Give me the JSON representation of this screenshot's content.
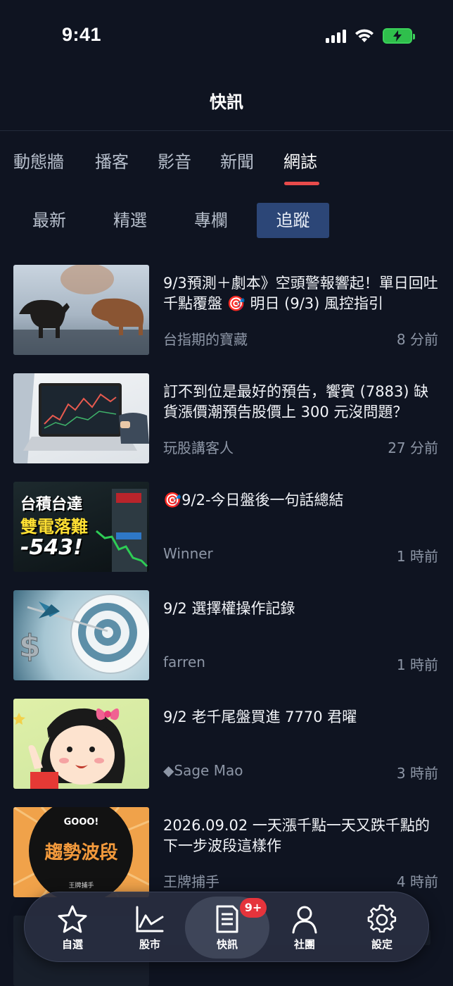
{
  "status": {
    "time": "9:41"
  },
  "header": {
    "title": "快訊"
  },
  "main_tabs": [
    "動態牆",
    "播客",
    "影音",
    "新聞",
    "網誌"
  ],
  "main_tab_active": "網誌",
  "sub_tabs": [
    "最新",
    "精選",
    "專欄",
    "追蹤"
  ],
  "sub_tab_active": "追蹤",
  "feed": [
    {
      "title": "9/3預測＋劇本》空頭警報響起！單日回吐千點覆盤 🎯 明日 (9/3) 風控指引",
      "author": "台指期的寶藏",
      "time": "8 分前"
    },
    {
      "title": "訂不到位是最好的預告，饗賓 (7883) 缺貨漲價潮預告股價上 300 元沒問題？",
      "author": "玩股講客人",
      "time": "27 分前"
    },
    {
      "title": "🎯9/2-今日盤後一句話總結",
      "author": "Winner",
      "time": "1 時前",
      "thumb_text_1": "台積台達",
      "thumb_text_2": "雙電落難",
      "thumb_text_3": "-543!"
    },
    {
      "title": "9/2 選擇權操作記錄",
      "author": "farren",
      "time": "1 時前"
    },
    {
      "title": "9/2 老千尾盤買進 7770 君曜",
      "author": "◆Sage Mao",
      "time": "3 時前"
    },
    {
      "title": "2026.09.02 一天漲千點一天又跌千點的下一步波段這樣作",
      "author": "王牌捕手",
      "time": "4 時前",
      "thumb_text_1": "GOOO!",
      "thumb_text_2": "趨勢波段",
      "thumb_text_3": "王牌捕手"
    }
  ],
  "bottom_nav": [
    {
      "label": "自選",
      "icon": "star-icon"
    },
    {
      "label": "股市",
      "icon": "chart-line-icon"
    },
    {
      "label": "快訊",
      "icon": "news-icon",
      "badge": "9+"
    },
    {
      "label": "社團",
      "icon": "person-icon"
    },
    {
      "label": "設定",
      "icon": "gear-icon"
    }
  ],
  "colors": {
    "background": "#0f1421",
    "accent_underline": "#e84b4b",
    "active_sub_tab": "#2c4677",
    "badge": "#e5343c"
  }
}
